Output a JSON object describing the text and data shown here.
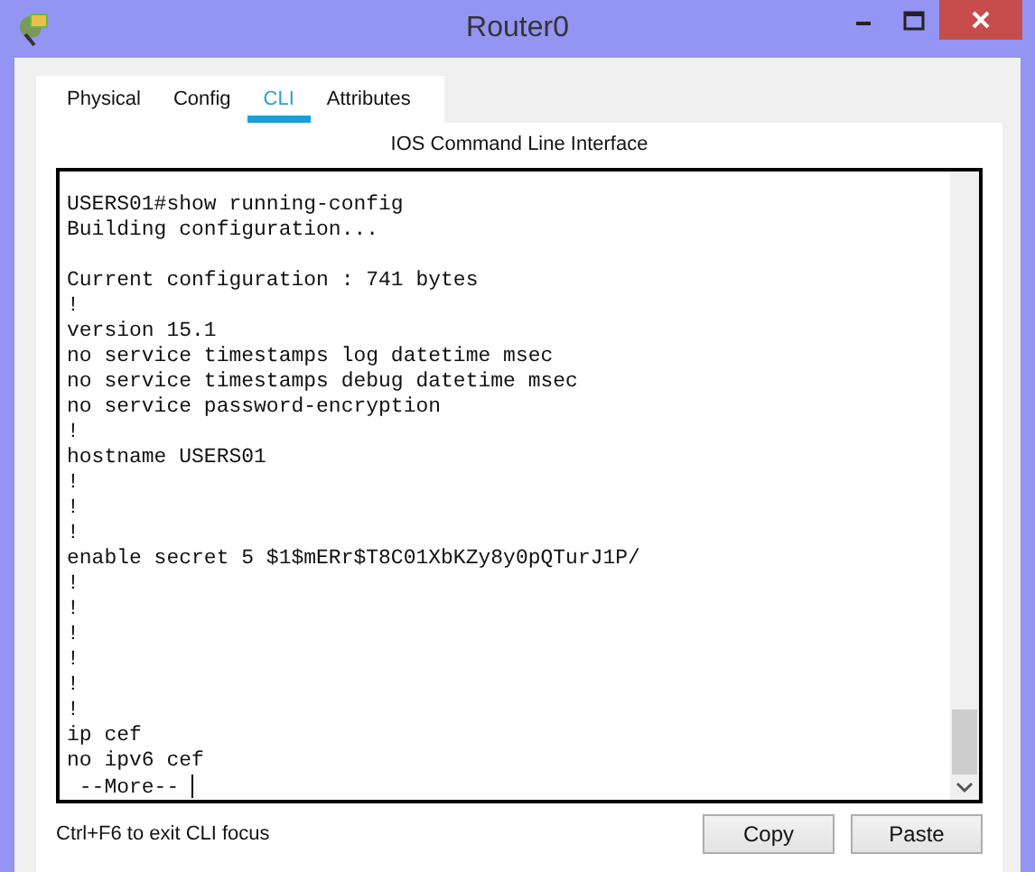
{
  "window": {
    "title": "Router0"
  },
  "tabs": [
    {
      "label": "Physical",
      "selected": false
    },
    {
      "label": "Config",
      "selected": false
    },
    {
      "label": "CLI",
      "selected": true
    },
    {
      "label": "Attributes",
      "selected": false
    }
  ],
  "panel_title": "IOS Command Line Interface",
  "terminal": {
    "lines": [
      "USERS01#show running-config",
      "Building configuration...",
      "Current configuration : 741 bytes",
      "!",
      "version 15.1",
      "no service timestamps log datetime msec",
      "no service timestamps debug datetime msec",
      "no service password-encryption",
      "!",
      "hostname USERS01",
      "!",
      "!",
      "!",
      "enable secret 5 $1$mERr$T8C01XbKZy8y0pQTurJ1P/",
      "!",
      "!",
      "!",
      "!",
      "!",
      "!",
      "ip cef",
      "no ipv6 cef"
    ],
    "prompt": " --More-- "
  },
  "hint": "Ctrl+F6 to exit CLI focus",
  "buttons": [
    "Copy",
    "Paste"
  ]
}
